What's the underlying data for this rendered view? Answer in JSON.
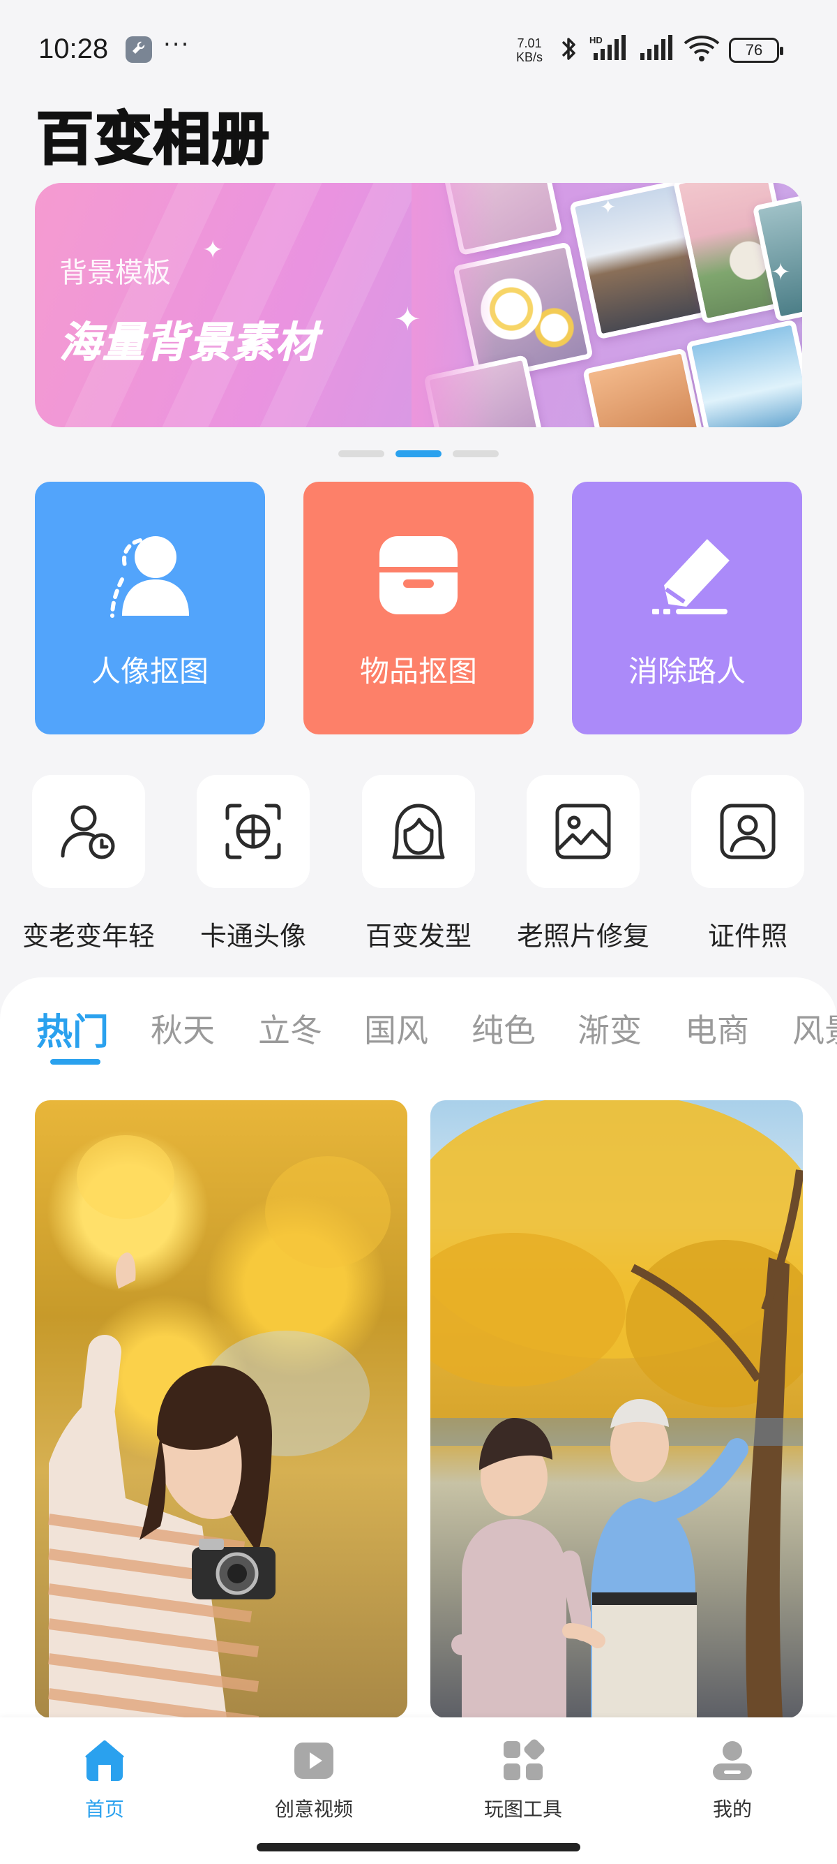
{
  "status_bar": {
    "time": "10:28",
    "more": "···",
    "net_speed_value": "7.01",
    "net_speed_unit": "KB/s",
    "battery": "76",
    "icons": [
      "wrench-icon",
      "bluetooth-icon",
      "signal-hd-icon",
      "signal-icon",
      "wifi-icon",
      "battery-icon"
    ]
  },
  "app": {
    "title": "百变相册"
  },
  "banner": {
    "subtitle": "背景模板",
    "headline": "海量背景素材",
    "page_count": 3,
    "active_page": 2
  },
  "main_tools": [
    {
      "label": "人像抠图",
      "icon": "portrait-cutout-icon",
      "color": "#52a4fb"
    },
    {
      "label": "物品抠图",
      "icon": "box-cutout-icon",
      "color": "#fd8069"
    },
    {
      "label": "消除路人",
      "icon": "eraser-icon",
      "color": "#ab8af9"
    }
  ],
  "small_tools": [
    {
      "label": "变老变年轻",
      "icon": "age-clock-icon"
    },
    {
      "label": "卡通头像",
      "icon": "cartoon-face-scan-icon"
    },
    {
      "label": "百变发型",
      "icon": "hairstyle-icon"
    },
    {
      "label": "老照片修复",
      "icon": "photo-restore-icon"
    },
    {
      "label": "证件照",
      "icon": "id-photo-icon"
    }
  ],
  "category_tabs": [
    "热门",
    "秋天",
    "立冬",
    "国风",
    "纯色",
    "渐变",
    "电商",
    "风景"
  ],
  "active_tab": "热门",
  "bottom_nav": [
    {
      "label": "首页",
      "icon": "home-icon",
      "active": true
    },
    {
      "label": "创意视频",
      "icon": "video-play-icon",
      "active": false
    },
    {
      "label": "玩图工具",
      "icon": "tools-grid-icon",
      "active": false
    },
    {
      "label": "我的",
      "icon": "profile-icon",
      "active": false
    }
  ],
  "colors": {
    "accent": "#2aa1ee",
    "tile_blue": "#52a4fb",
    "tile_orange": "#fd8069",
    "tile_purple": "#ab8af9"
  }
}
